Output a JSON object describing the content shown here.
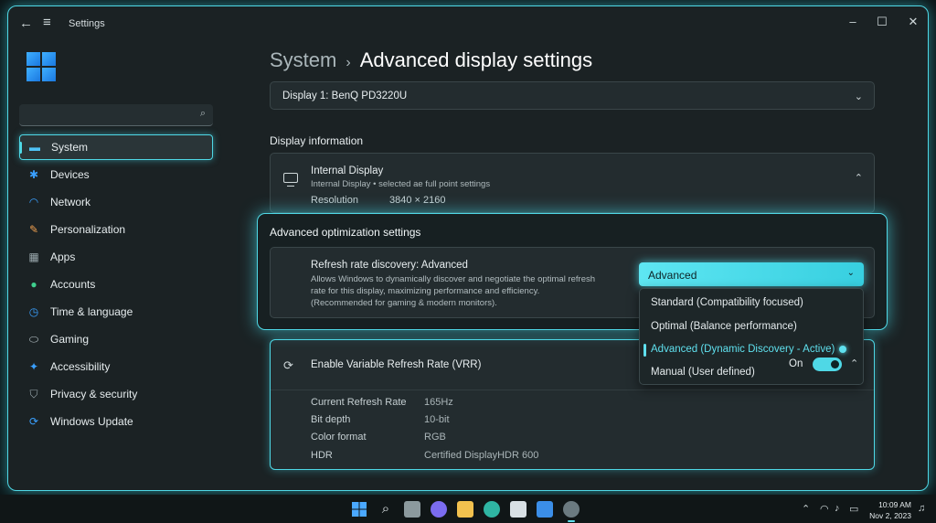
{
  "window": {
    "title": "Settings"
  },
  "titlebar": {
    "back_icon": "back-arrow-icon",
    "menu_icon": "hamburger-icon",
    "minimize": "–",
    "maximize": "☐",
    "close": "✕"
  },
  "search": {
    "placeholder": ""
  },
  "sidebar": {
    "items": [
      {
        "label": "System",
        "icon": "system-icon",
        "color": "#4fc3f7",
        "active": true
      },
      {
        "label": "Devices",
        "icon": "bluetooth-icon",
        "color": "#3aa0ff"
      },
      {
        "label": "Network",
        "icon": "wifi-icon",
        "color": "#3aa0ff"
      },
      {
        "label": "Personalization",
        "icon": "brush-icon",
        "color": "#f0a050"
      },
      {
        "label": "Apps",
        "icon": "apps-icon",
        "color": "#9aa8ad"
      },
      {
        "label": "Accounts",
        "icon": "person-icon",
        "color": "#3fcf8e"
      },
      {
        "label": "Time & language",
        "icon": "clock-globe-icon",
        "color": "#3aa0ff"
      },
      {
        "label": "Gaming",
        "icon": "gamepad-icon",
        "color": "#b8c4c8"
      },
      {
        "label": "Accessibility",
        "icon": "accessibility-icon",
        "color": "#3aa0ff"
      },
      {
        "label": "Privacy & security",
        "icon": "shield-icon",
        "color": "#9aa8ad"
      },
      {
        "label": "Windows Update",
        "icon": "refresh-icon",
        "color": "#3aa0ff"
      }
    ]
  },
  "breadcrumb": {
    "parent": "System",
    "separator": "›",
    "current": "Advanced display settings"
  },
  "display_select": {
    "value": "Display 1: BenQ PD3220U"
  },
  "display_info": {
    "heading": "Display information",
    "title": "Internal Display",
    "subtitle": "Internal Display  •  selected ae full point settings",
    "resolution_label": "Resolution",
    "resolution_value": "3840 × 2160"
  },
  "optimization": {
    "heading": "Advanced optimization settings",
    "refresh_title": "Refresh rate discovery: Advanced",
    "refresh_desc_1": "Allows Windows to dynamically discover and negotiate the optimal refresh",
    "refresh_desc_2": "rate for this display, maximizing performance and efficiency.",
    "refresh_desc_3": "(Recommended for gaming & modern monitors).",
    "dropdown_value": "Advanced",
    "options": [
      "Standard (Compatibility focused)",
      "Optimal (Balance performance)",
      "Advanced (Dynamic Discovery - Active)",
      "Manual (User defined)"
    ],
    "selected_index": 2
  },
  "vrr": {
    "title": "Enable Variable Refresh Rate (VRR)",
    "toggle_label": "On",
    "toggle_on": true,
    "specs": [
      {
        "label": "Current Refresh Rate",
        "value": "165Hz"
      },
      {
        "label": "Bit depth",
        "value": "10-bit"
      },
      {
        "label": "Color format",
        "value": "RGB"
      },
      {
        "label": "HDR",
        "value": "Certified DisplayHDR 600"
      }
    ]
  },
  "taskbar": {
    "icons": [
      "windows-start-icon",
      "search-icon",
      "task-view-icon",
      "chat-icon",
      "file-explorer-icon",
      "edge-icon",
      "store-icon",
      "mail-icon",
      "settings-icon"
    ],
    "time": "10:09 AM",
    "date": "Nov 2, 2023"
  },
  "colors": {
    "accent": "#4fd8e6",
    "background": "#1b2224"
  }
}
